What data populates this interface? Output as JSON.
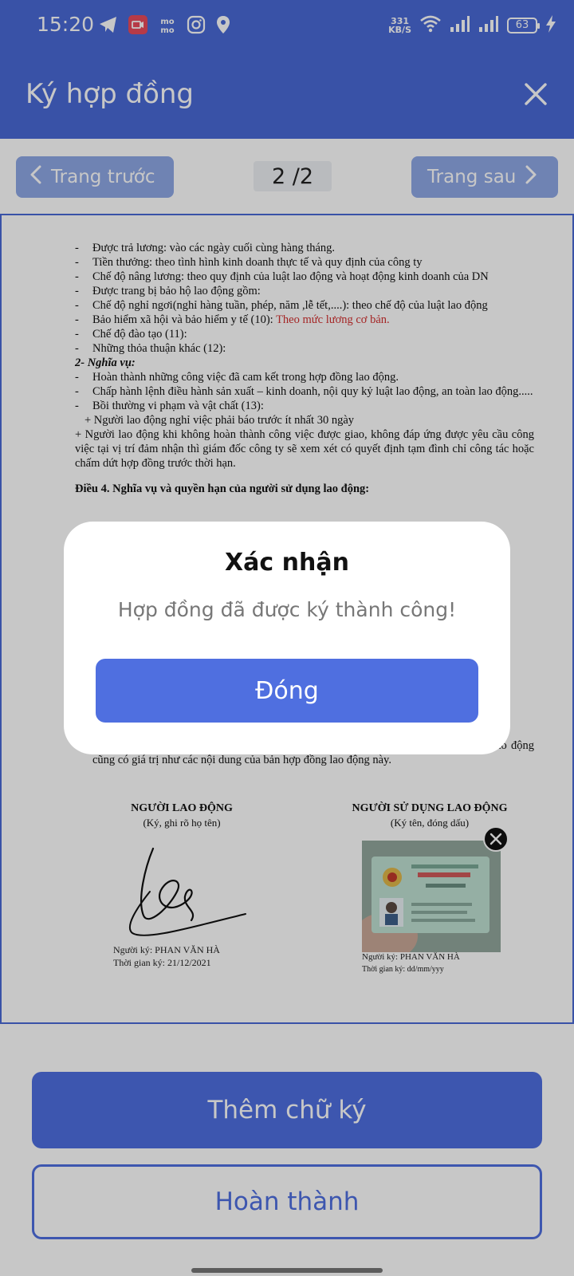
{
  "status_bar": {
    "time": "15:20",
    "speed_value": "331",
    "speed_unit": "KB/S",
    "battery": "63"
  },
  "app_bar": {
    "title": "Ký hợp đồng"
  },
  "pager": {
    "prev_label": "Trang trước",
    "next_label": "Trang sau",
    "page_count": "2 /2"
  },
  "document": {
    "lines": [
      "Được trả lương: vào các ngày cuối cùng hàng tháng.",
      "Tiền thưởng: theo tình hình kinh doanh thực tế và quy định của công ty",
      "Chế độ nâng lương: theo quy định của luật lao động và hoạt động kinh doanh của DN",
      "Được trang bị bảo hộ lao động gồm:",
      "Chế độ nghỉ ngơi(nghỉ hàng tuần, phép, năm ,lễ tết,....): theo chế độ của luật lao động",
      "Bảo hiểm xã hội và bảo hiểm y tế (10): ",
      "Chế độ đào tạo (11):",
      "Những thỏa thuận khác (12):"
    ],
    "insurance_note": "Theo mức lương cơ bản.",
    "obligations_heading": "2- Nghĩa vụ:",
    "obligations": [
      "Hoàn thành những công việc đã cam kết trong hợp đồng lao động.",
      "Chấp hành lệnh điều hành sản xuất – kinh doanh, nội quy kỷ luật lao động, an toàn lao động.....",
      "Bồi thường vi phạm và vật chất (13):"
    ],
    "plus_1": "+ Người lao động nghỉ việc phải báo trước ít nhất 30 ngày",
    "plus_2": "+ Người lao động khi không hoàn thành công việc được giao, không đáp ứng được yêu cầu công việc tại vị trí đảm nhận thì giám đốc công ty sẽ xem xét có quyết định tạm đình chỉ công tác hoặc chấm dứt hợp đồng trước thời hạn.",
    "article_4": "Điều 4. Nghĩa vụ và quyền hạn của người sử dụng lao động:",
    "appendix_line": "Khi hai bên ký kết phụ lục hợp đồng lao động thì nội dung của phụ lục hợp đồng lao động cũng có giá trị như các nội dung của bản hợp đồng lao động này.",
    "sig_left_head": "NGƯỜI LAO ĐỘNG",
    "sig_left_sub": "(Ký, ghi rõ họ tên)",
    "sig_left_by": "Người ký: PHAN VĂN HÀ",
    "sig_left_time": "Thời gian ký: 21/12/2021",
    "sig_right_head": "NGƯỜI SỬ DỤNG LAO ĐỘNG",
    "sig_right_sub": "(Ký tên, đóng dấu)",
    "sig_right_by": "Người ký: PHAN VĂN HÀ",
    "sig_right_time": "Thời gian ký: dd/mm/yyy"
  },
  "bottom": {
    "add_signature_label": "Thêm chữ ký",
    "finish_label": "Hoàn thành"
  },
  "dialog": {
    "title": "Xác nhận",
    "message": "Hợp đồng đã được ký thành công!",
    "close_label": "Đóng"
  },
  "colors": {
    "primary": "#4a69d6",
    "button": "#4f6fe0",
    "note_red": "#d32f2f"
  }
}
